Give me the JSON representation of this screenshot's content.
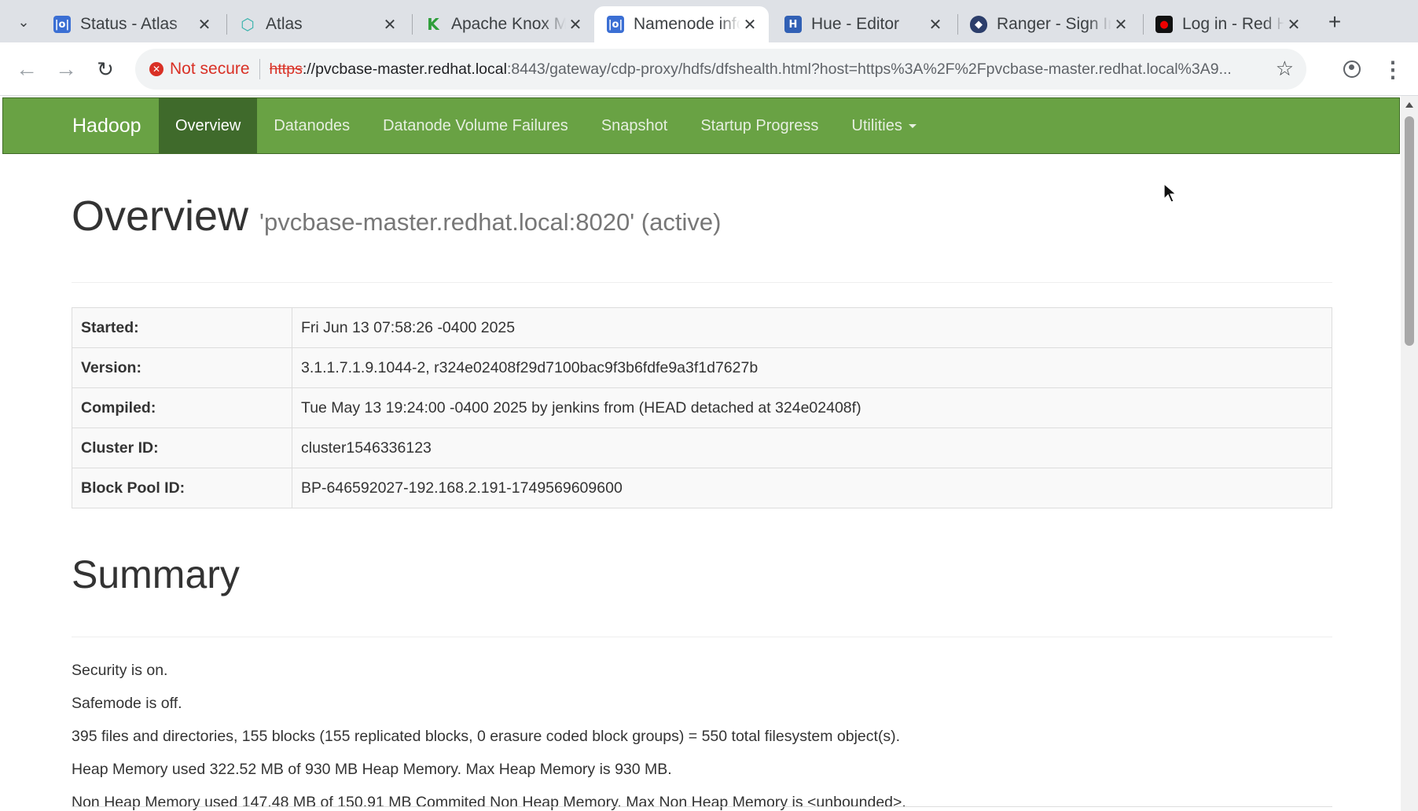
{
  "browser": {
    "tabs": [
      {
        "title": "Status - Atlas",
        "favicon": "prometheus-icon",
        "color": "#3b6fd4",
        "active": false
      },
      {
        "title": "Atlas",
        "favicon": "atlas-icon",
        "color": "#38b2ac",
        "active": false
      },
      {
        "title": "Apache Knox Manager",
        "favicon": "knox-icon",
        "color": "#2e9e3a",
        "active": false
      },
      {
        "title": "Namenode information",
        "favicon": "namenode-icon",
        "color": "#3b6fd4",
        "active": true
      },
      {
        "title": "Hue - Editor",
        "favicon": "hue-icon",
        "color": "#3160b5",
        "active": false
      },
      {
        "title": "Ranger - Sign In",
        "favicon": "ranger-icon",
        "color": "#2c3e6b",
        "active": false
      },
      {
        "title": "Log in - Red Hat",
        "favicon": "redhat-icon",
        "color": "#111111",
        "active": false
      }
    ],
    "security_label": "Not secure",
    "url_scheme": "https",
    "url_host": "://pvcbase-master.redhat.local",
    "url_rest": ":8443/gateway/cdp-proxy/hdfs/dfshealth.html?host=https%3A%2F%2Fpvcbase-master.redhat.local%3A9..."
  },
  "navbar": {
    "brand": "Hadoop",
    "items": [
      "Overview",
      "Datanodes",
      "Datanode Volume Failures",
      "Snapshot",
      "Startup Progress",
      "Utilities"
    ],
    "active": "Overview"
  },
  "overview": {
    "heading": "Overview",
    "subtitle": "'pvcbase-master.redhat.local:8020' (active)",
    "rows": [
      {
        "key": "Started:",
        "value": "Fri Jun 13 07:58:26 -0400 2025"
      },
      {
        "key": "Version:",
        "value": "3.1.1.7.1.9.1044-2, r324e02408f29d7100bac9f3b6fdfe9a3f1d7627b"
      },
      {
        "key": "Compiled:",
        "value": "Tue May 13 19:24:00 -0400 2025 by jenkins from (HEAD detached at 324e02408f)"
      },
      {
        "key": "Cluster ID:",
        "value": "cluster1546336123"
      },
      {
        "key": "Block Pool ID:",
        "value": "BP-646592027-192.168.2.191-1749569609600"
      }
    ]
  },
  "summary": {
    "heading": "Summary",
    "lines": [
      "Security is on.",
      "Safemode is off.",
      "395 files and directories, 155 blocks (155 replicated blocks, 0 erasure coded block groups) = 550 total filesystem object(s).",
      "Heap Memory used 322.52 MB of 930 MB Heap Memory. Max Heap Memory is 930 MB.",
      "Non Heap Memory used 147.48 MB of 150.91 MB Commited Non Heap Memory. Max Non Heap Memory is <unbounded>."
    ]
  },
  "colors": {
    "navbar_bg": "#69a244",
    "navbar_active": "#3f6a2b",
    "insecure_red": "#d93025"
  }
}
